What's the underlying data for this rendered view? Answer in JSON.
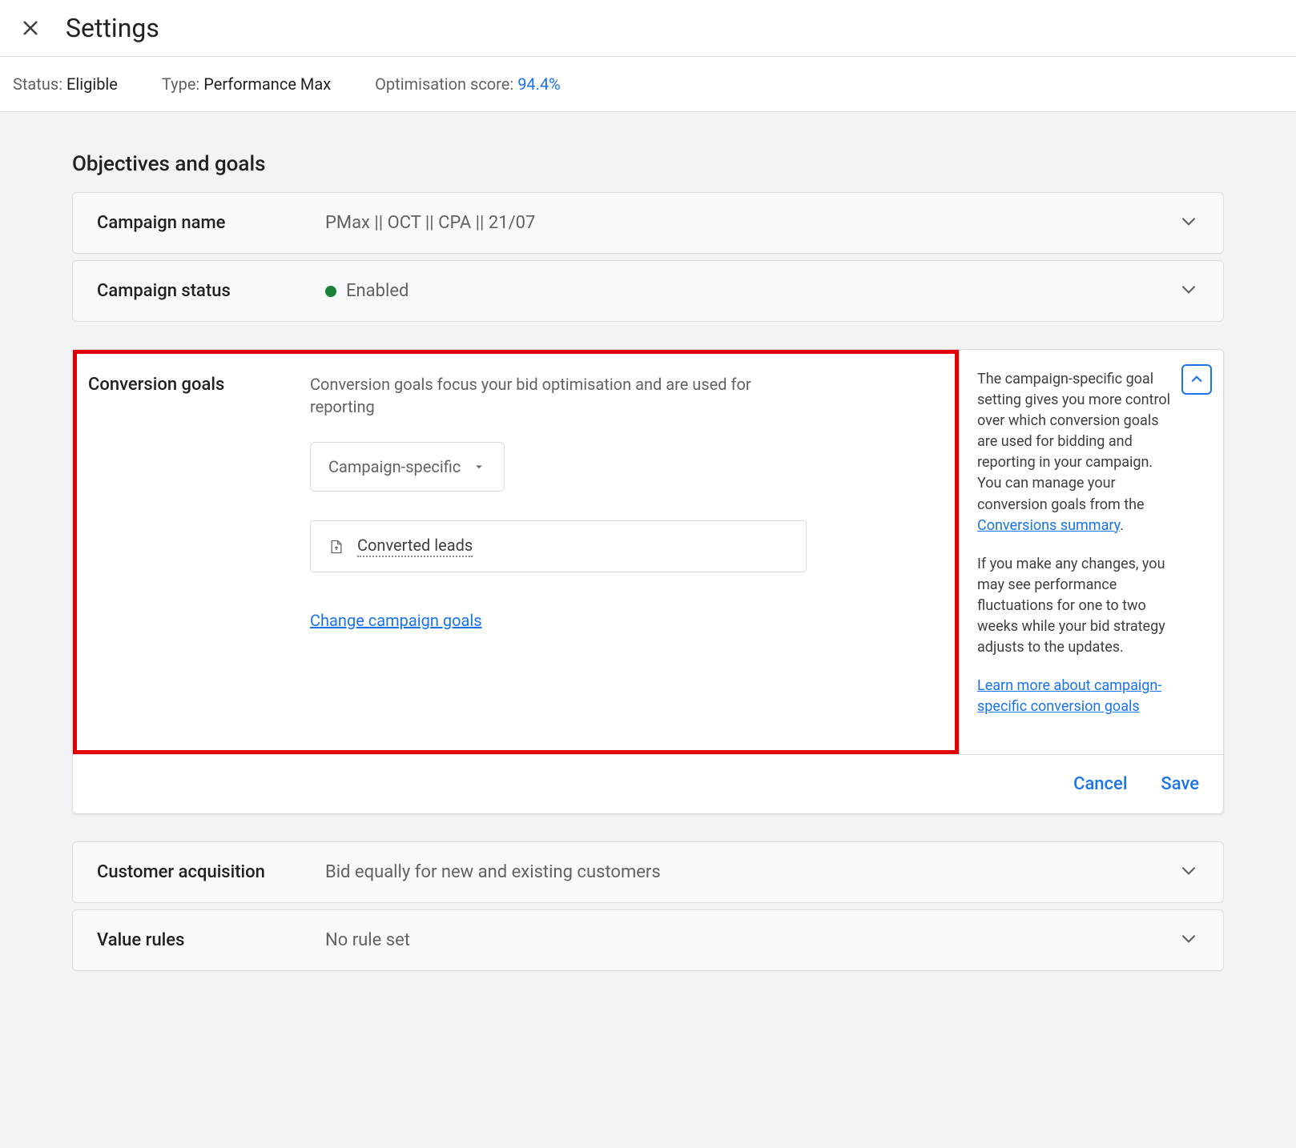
{
  "header": {
    "title": "Settings"
  },
  "statusbar": {
    "status_label": "Status: ",
    "status_value": "Eligible",
    "type_label": "Type: ",
    "type_value": "Performance Max",
    "opt_label": "Optimisation score: ",
    "opt_value": "94.4%"
  },
  "section": {
    "title": "Objectives and goals"
  },
  "rows": {
    "campaign_name": {
      "label": "Campaign name",
      "value": "PMax || OCT || CPA || 21/07"
    },
    "campaign_status": {
      "label": "Campaign status",
      "value": "Enabled"
    },
    "customer_acq": {
      "label": "Customer acquisition",
      "value": "Bid equally for new and existing customers"
    },
    "value_rules": {
      "label": "Value rules",
      "value": "No rule set"
    }
  },
  "conv": {
    "label": "Conversion goals",
    "desc": "Conversion goals focus your bid optimisation and are used for reporting",
    "dropdown": "Campaign-specific",
    "goal_item": "Converted leads",
    "change_link": "Change campaign goals"
  },
  "side": {
    "p1a": "The campaign-specific goal setting gives you more control over which conversion goals are used for bidding and reporting in your campaign. You can manage your conversion goals from the ",
    "p1_link": "Conversions summary",
    "p1b": ".",
    "p2": "If you make any changes, you may see performance fluctuations for one to two weeks while your bid strategy adjusts to the updates.",
    "p3_link": "Learn more about campaign-specific conversion goals"
  },
  "actions": {
    "cancel": "Cancel",
    "save": "Save"
  }
}
